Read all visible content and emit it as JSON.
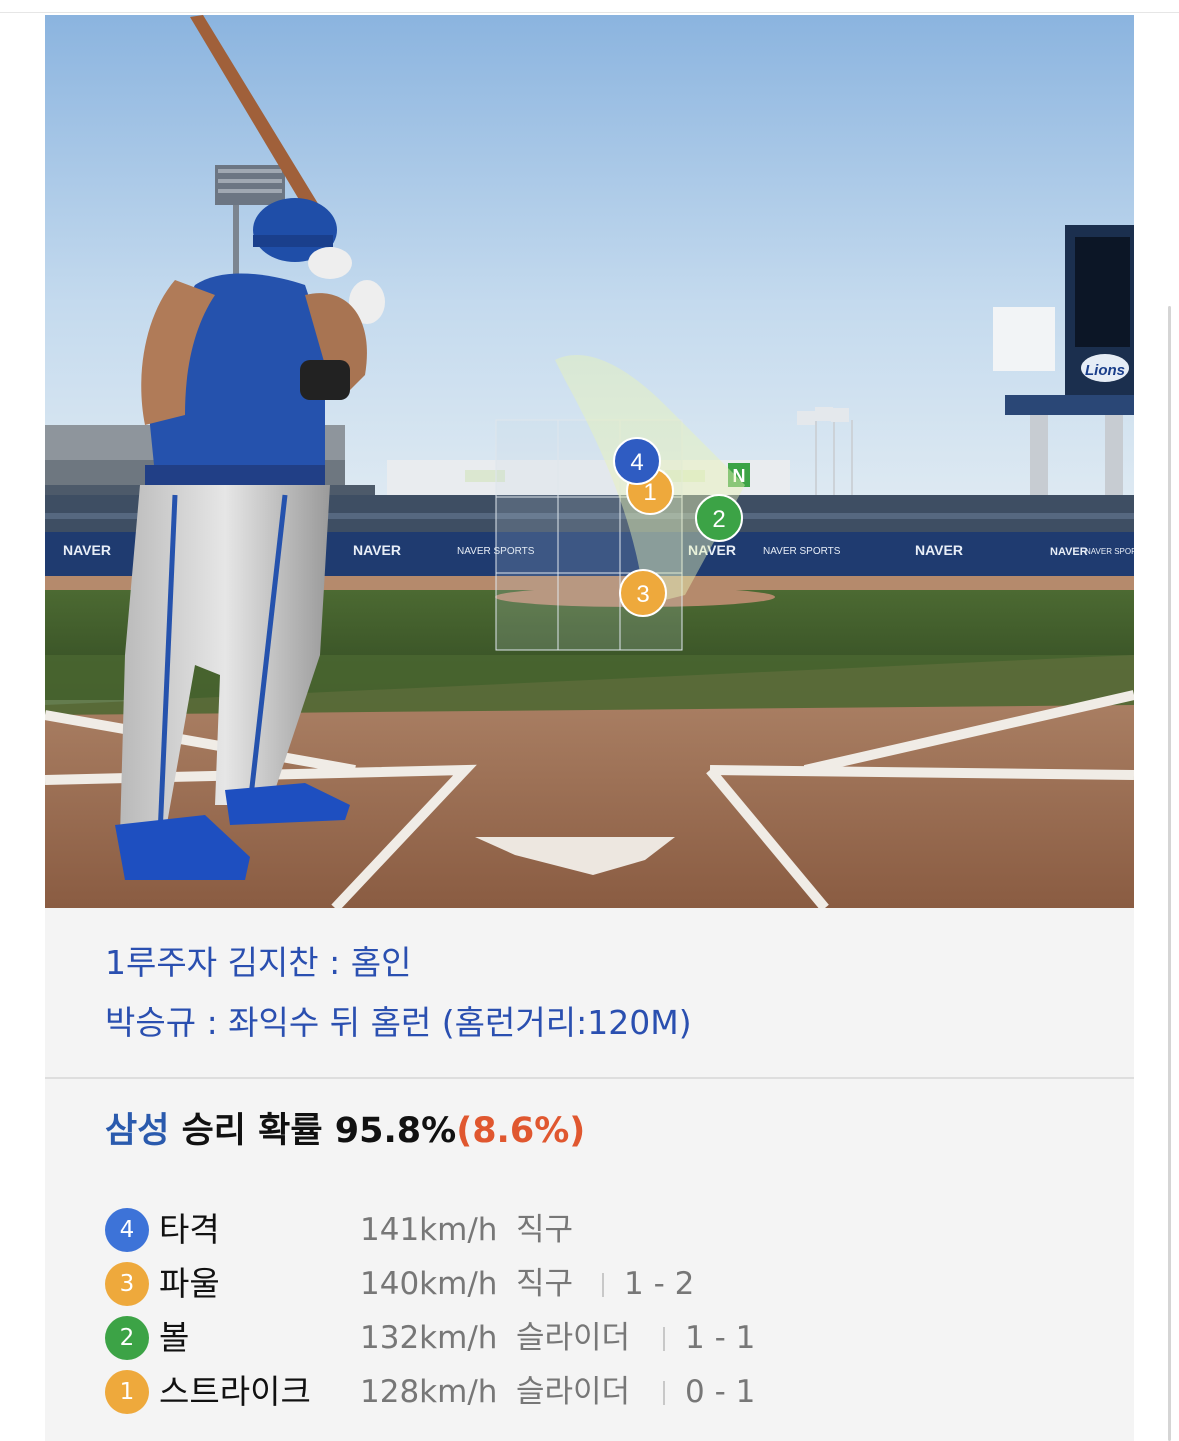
{
  "scene": {
    "ad_boards": [
      "NAVER",
      "NAVER",
      "NAVER",
      "NAVER",
      "NAVER"
    ],
    "sports_boards": [
      "NAVER SPORTS",
      "NAVER SPORTS",
      "NAVER SPORTS"
    ],
    "team_logo": "Lions",
    "n_logo": "N",
    "pitch_markers": [
      "4",
      "1",
      "2",
      "3"
    ]
  },
  "play_by_play": [
    "1루주자 김지찬 : 홈인",
    "박승규 : 좌익수 뒤 홈런 (홈런거리:120M)"
  ],
  "win_probability": {
    "team": "삼성",
    "label": " 승리 확률 ",
    "value": "95.8%",
    "change": "(8.6%)"
  },
  "pitches": [
    {
      "num": "4",
      "result": "타격",
      "speed": "141km/h",
      "type": "직구",
      "count": "",
      "color": "#3d73d8"
    },
    {
      "num": "3",
      "result": "파울",
      "speed": "140km/h",
      "type": "직구",
      "count": "1 - 2",
      "color": "#eea93c"
    },
    {
      "num": "2",
      "result": "볼",
      "speed": "132km/h",
      "type": "슬라이더",
      "count": "1 - 1",
      "color": "#3ca346"
    },
    {
      "num": "1",
      "result": "스트라이크",
      "speed": "128km/h",
      "type": "슬라이더",
      "count": "0 - 1",
      "color": "#eea93c"
    }
  ],
  "colors": {
    "play_text": "#2a4fb0",
    "team": "#2a5aad",
    "change": "#e0572f",
    "ball_blue": "#3d73d8",
    "ball_orange": "#eea93c",
    "ball_green": "#3ca346"
  }
}
